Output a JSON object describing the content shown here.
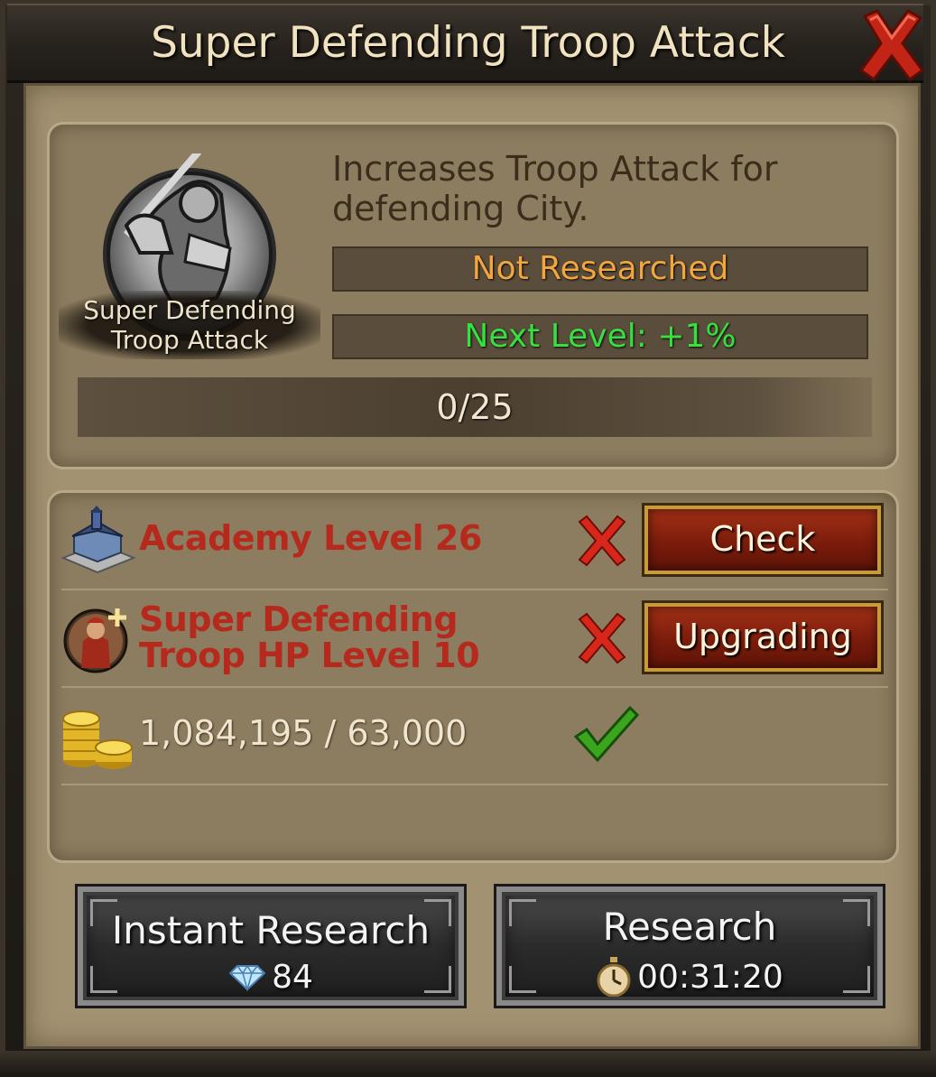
{
  "window": {
    "title": "Super Defending Troop Attack"
  },
  "research": {
    "emblem_label": "Super Defending Troop Attack",
    "description": "Increases Troop Attack for defending City.",
    "status": "Not Researched",
    "next_level": "Next Level: +1%",
    "progress_text": "0/25",
    "progress_fraction": 0
  },
  "requirements": [
    {
      "label": "Academy Level 26",
      "icon": "academy-building-icon",
      "met": false,
      "button": "Check"
    },
    {
      "label": "Super Defending Troop HP Level 10",
      "icon": "troop-hp-icon",
      "met": false,
      "button": "Upgrading"
    },
    {
      "value": "1,084,195 / 63,000",
      "icon": "gold-coins-icon",
      "met": true
    }
  ],
  "actions": {
    "instant_label": "Instant Research",
    "instant_cost": "84",
    "instant_cost_icon": "diamond-icon",
    "research_label": "Research",
    "research_time": "00:31:20",
    "research_time_icon": "stopwatch-icon"
  },
  "colors": {
    "title_text": "#f1e3bf",
    "status_orange": "#f2a640",
    "next_green": "#35e040",
    "requirement_red": "#b62a1d"
  }
}
